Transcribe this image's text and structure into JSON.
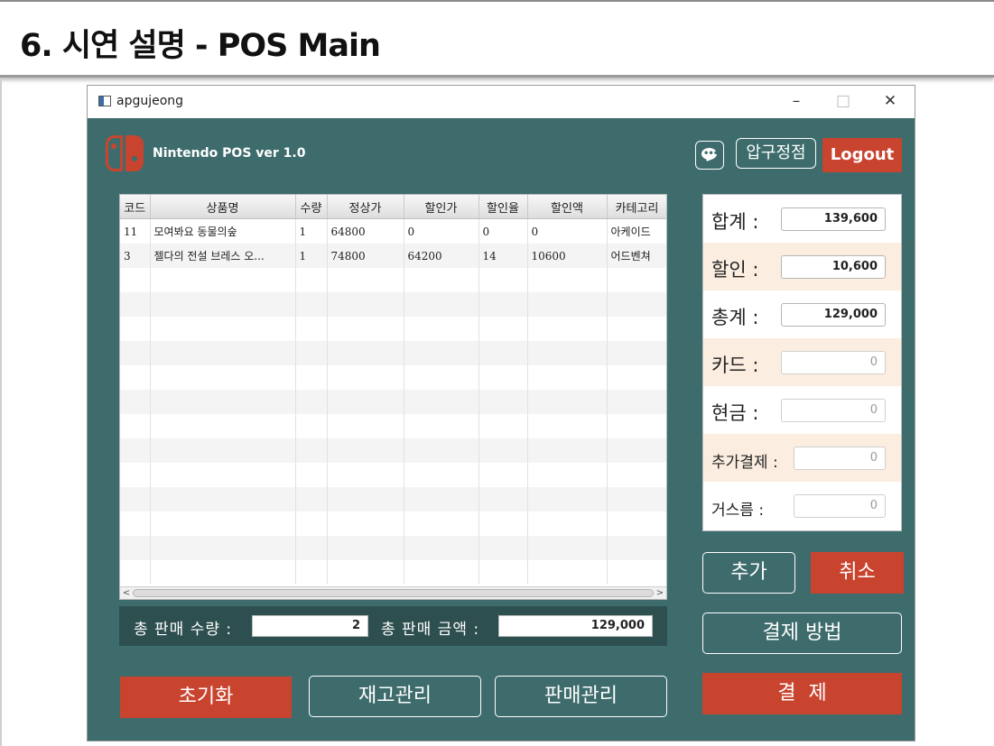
{
  "slide": {
    "title": "6. 시연 설명 - POS Main"
  },
  "window": {
    "title": "apgujeong",
    "controls": {
      "minimize": "–",
      "maximize": "□",
      "close": "✕"
    }
  },
  "header": {
    "app_name": "Nintendo POS ver 1.0",
    "chat_icon": "chat-bubble-icon",
    "store_label": "압구정점",
    "logout_label": "Logout"
  },
  "colors": {
    "accent": "#c9442f",
    "background": "#3e6c6c",
    "summary_bar": "#2d4f4f",
    "highlight_row": "#fbeee0"
  },
  "table": {
    "columns": [
      "코드",
      "상품명",
      "수량",
      "정상가",
      "할인가",
      "할인율",
      "할인액",
      "카테고리"
    ],
    "rows": [
      [
        "11",
        "모여봐요 동물의숲",
        "1",
        "64800",
        "0",
        "0",
        "0",
        "아케이드"
      ],
      [
        "3",
        "젤다의 전설 브레스 오...",
        "1",
        "74800",
        "64200",
        "14",
        "10600",
        "어드벤쳐"
      ]
    ],
    "scroll_left": "<",
    "scroll_right": ">"
  },
  "summary": {
    "qty_label": "총 판매 수량 :",
    "qty_value": "2",
    "amount_label": "총 판매 금액 :",
    "amount_value": "129,000"
  },
  "payment": {
    "rows": [
      {
        "label": "합계 :",
        "value": "139,600"
      },
      {
        "label": "할인 :",
        "value": "10,600"
      },
      {
        "label": "총계 :",
        "value": "129,000"
      },
      {
        "label": "카드 :",
        "value": "0"
      },
      {
        "label": "현금 :",
        "value": "0"
      },
      {
        "label": "추가결제 :",
        "value": "0"
      },
      {
        "label": "거스름 :",
        "value": "0"
      }
    ]
  },
  "buttons": {
    "add": "추가",
    "cancel": "취소",
    "pay_method": "결제 방법",
    "pay": "결  제",
    "reset": "초기화",
    "inventory": "재고관리",
    "sales": "판매관리"
  }
}
